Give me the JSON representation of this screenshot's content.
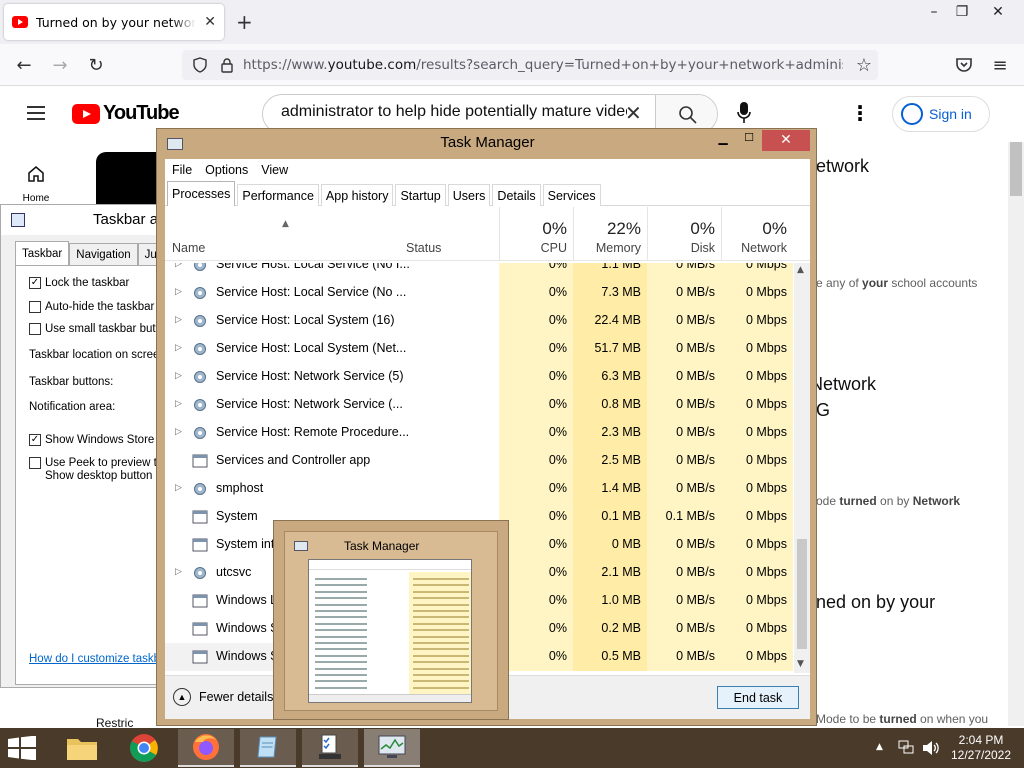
{
  "browser": {
    "tab_title": "Turned on by your network administrator to help hide potentially mature videos",
    "url_prefix": "https://www.",
    "url_domain": "youtube.com",
    "url_rest": "/results?search_query=Turned+on+by+your+network+administrator+to"
  },
  "youtube": {
    "logo_text": "YouTube",
    "search_value": "administrator to help hide potentially mature videos",
    "signin_label": "Sign in",
    "home_label": "Home",
    "bg_texts": {
      "t1": "etwork",
      "t2_pre": "e any of ",
      "t2_bold": "your",
      "t2_post": " school accounts",
      "t3": "Network",
      "t4": "G",
      "t5_pre": "ode ",
      "t5_b1": "turned",
      "t5_mid": " on by ",
      "t5_b2": "Network",
      "t6": "ned on by your",
      "t7_pre": "Mode to be ",
      "t7_bold": "turned",
      "t7_post": " on when you",
      "t8": "Restric"
    }
  },
  "taskbar_props": {
    "title": "Taskbar and Navigation properties",
    "tabs": [
      "Taskbar",
      "Navigation",
      "Jump Lists"
    ],
    "lock": "Lock the taskbar",
    "autohide": "Auto-hide the taskbar",
    "small": "Use small taskbar buttons",
    "location": "Taskbar location on screen:",
    "buttons": "Taskbar buttons:",
    "notif": "Notification area:",
    "store": "Show Windows Store apps on the taskbar",
    "peek1": "Use Peek to preview the desktop when you move your mouse to the",
    "peek2": "Show desktop button at the end of the taskbar",
    "link": "How do I customize taskbars?"
  },
  "task_manager": {
    "title": "Task Manager",
    "menu": [
      "File",
      "Options",
      "View"
    ],
    "tabs": [
      "Processes",
      "Performance",
      "App history",
      "Startup",
      "Users",
      "Details",
      "Services"
    ],
    "columns": {
      "name": "Name",
      "status": "Status",
      "cpu_pct": "0%",
      "cpu": "CPU",
      "mem_pct": "22%",
      "mem": "Memory",
      "disk_pct": "0%",
      "disk": "Disk",
      "net_pct": "0%",
      "net": "Network"
    },
    "rows": [
      {
        "name": "Service Host: Local Service (No I...",
        "cpu": "0%",
        "mem": "1.1 MB",
        "disk": "0 MB/s",
        "net": "0 Mbps"
      },
      {
        "name": "Service Host: Local Service (No ...",
        "cpu": "0%",
        "mem": "7.3 MB",
        "disk": "0 MB/s",
        "net": "0 Mbps"
      },
      {
        "name": "Service Host: Local System (16)",
        "cpu": "0%",
        "mem": "22.4 MB",
        "disk": "0 MB/s",
        "net": "0 Mbps"
      },
      {
        "name": "Service Host: Local System (Net...",
        "cpu": "0%",
        "mem": "51.7 MB",
        "disk": "0 MB/s",
        "net": "0 Mbps"
      },
      {
        "name": "Service Host: Network Service (5)",
        "cpu": "0%",
        "mem": "6.3 MB",
        "disk": "0 MB/s",
        "net": "0 Mbps"
      },
      {
        "name": "Service Host: Network Service (...",
        "cpu": "0%",
        "mem": "0.8 MB",
        "disk": "0 MB/s",
        "net": "0 Mbps"
      },
      {
        "name": "Service Host: Remote Procedure...",
        "cpu": "0%",
        "mem": "2.3 MB",
        "disk": "0 MB/s",
        "net": "0 Mbps"
      },
      {
        "name": "Services and Controller app",
        "cpu": "0%",
        "mem": "2.5 MB",
        "disk": "0 MB/s",
        "net": "0 Mbps"
      },
      {
        "name": "smphost",
        "cpu": "0%",
        "mem": "1.4 MB",
        "disk": "0 MB/s",
        "net": "0 Mbps"
      },
      {
        "name": "System",
        "cpu": "0%",
        "mem": "0.1 MB",
        "disk": "0.1 MB/s",
        "net": "0 Mbps"
      },
      {
        "name": "System interrupts",
        "cpu": "0%",
        "mem": "0 MB",
        "disk": "0 MB/s",
        "net": "0 Mbps"
      },
      {
        "name": "utcsvc",
        "cpu": "0%",
        "mem": "2.1 MB",
        "disk": "0 MB/s",
        "net": "0 Mbps"
      },
      {
        "name": "Windows Logon Application",
        "cpu": "0%",
        "mem": "1.0 MB",
        "disk": "0 MB/s",
        "net": "0 Mbps"
      },
      {
        "name": "Windows Session Manager",
        "cpu": "0%",
        "mem": "0.2 MB",
        "disk": "0 MB/s",
        "net": "0 Mbps"
      },
      {
        "name": "Windows Start-Up Application",
        "cpu": "0%",
        "mem": "0.5 MB",
        "disk": "0 MB/s",
        "net": "0 Mbps"
      }
    ],
    "fewer_details": "Fewer details",
    "end_task": "End task"
  },
  "thumbnail": {
    "title": "Task Manager"
  },
  "clock": {
    "time": "2:04 PM",
    "date": "12/27/2022"
  },
  "colors": {
    "cpu_bg": "#fff4c4",
    "mem_bg": "#ffeca6",
    "yt_red": "#ff0000",
    "link_blue": "#065fd4",
    "taskbar": "#4a3a2a"
  }
}
